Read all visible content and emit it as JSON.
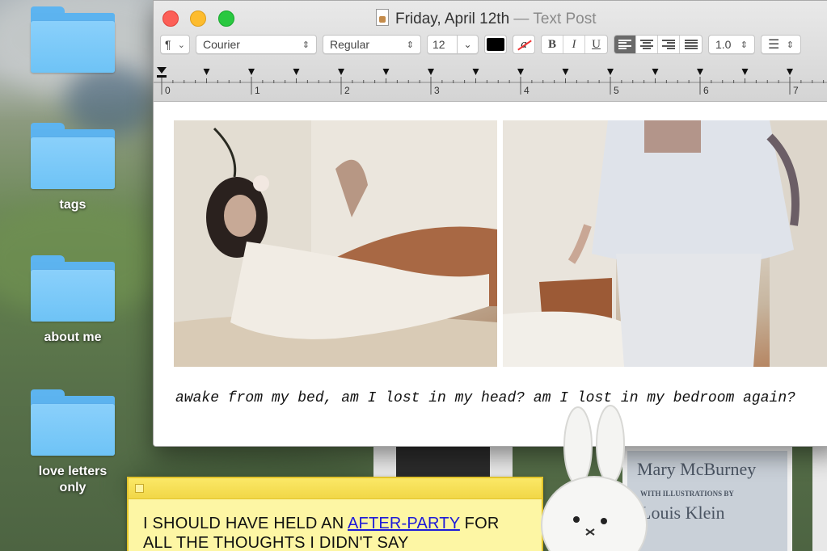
{
  "desktop": {
    "folders": [
      {
        "label": ""
      },
      {
        "label": "tags"
      },
      {
        "label": "about me"
      },
      {
        "label": "love letters\nonly"
      }
    ]
  },
  "window": {
    "title_main": "Friday, April 12th",
    "title_sep": " — ",
    "title_app": "Text Post",
    "toolbar": {
      "paragraph_label": "¶",
      "font_family": "Courier",
      "font_style": "Regular",
      "font_size": "12",
      "bold_label": "B",
      "italic_label": "I",
      "underline_label": "U",
      "spacing_value": "1.0",
      "text_color": "#000000"
    },
    "ruler_numbers": [
      "0",
      "1",
      "2",
      "3",
      "4",
      "5",
      "6",
      "7"
    ],
    "caption": "awake from my bed, am I lost in my head? am I lost in my bedroom again?"
  },
  "books": {
    "author": "Mary McBurney",
    "with_illustrations": "WITH ILLUSTRATIONS BY",
    "illustrator": "Louis Klein"
  },
  "sticky": {
    "text_before": "I SHOULD HAVE HELD AN ",
    "link_text": "AFTER-PARTY",
    "text_after": " FOR ALL THE THOUGHTS I DIDN'T SAY"
  },
  "colors": {
    "folder_blue": "#6ec3f6",
    "sticky_yellow": "#fdf6a4",
    "link_blue": "#1d1ad8",
    "close_red": "#fc5f57",
    "minimize_yellow": "#fdbc2e",
    "zoom_green": "#29c840"
  }
}
